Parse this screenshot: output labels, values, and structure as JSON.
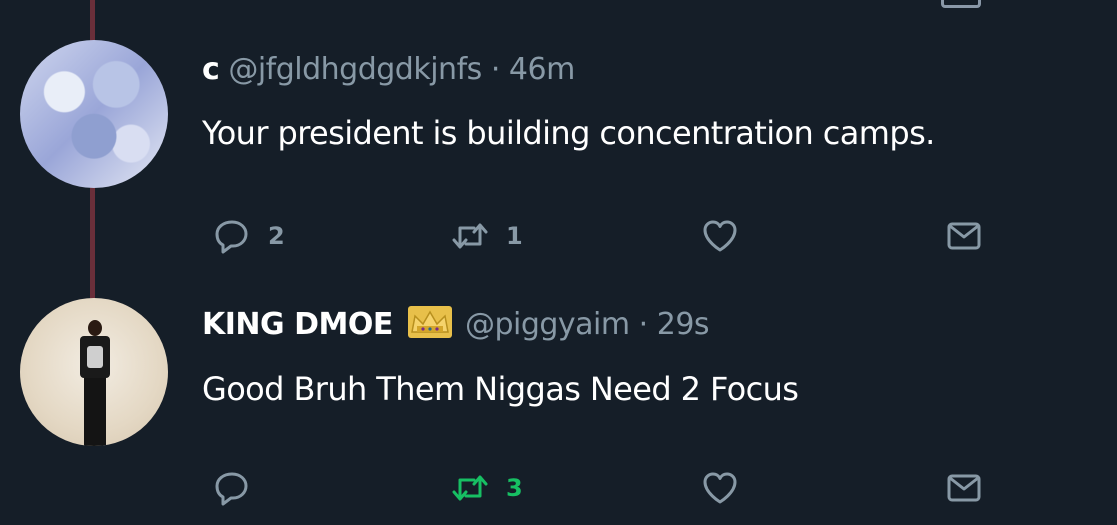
{
  "tweets": [
    {
      "name": "c",
      "handle": "@jfgldhgdgdkjnfs",
      "separator": "·",
      "time": "46m",
      "text": "Your president is building concentration camps.",
      "actions": {
        "reply_count": "2",
        "retweet_count": "1",
        "like_count": "",
        "retweet_active": false
      }
    },
    {
      "name": "KING DMOE",
      "name_emoji": "crown-icon",
      "handle": "@piggyaim",
      "separator": "·",
      "time": "29s",
      "text": "Good Bruh Them Niggas Need 2 Focus",
      "actions": {
        "reply_count": "",
        "retweet_count": "3",
        "like_count": "",
        "retweet_active": true
      }
    }
  ],
  "colors": {
    "background": "#151e28",
    "secondary_text": "#8899a6",
    "retweet_active": "#17bf63",
    "thread_line": "#6a2f3a"
  }
}
